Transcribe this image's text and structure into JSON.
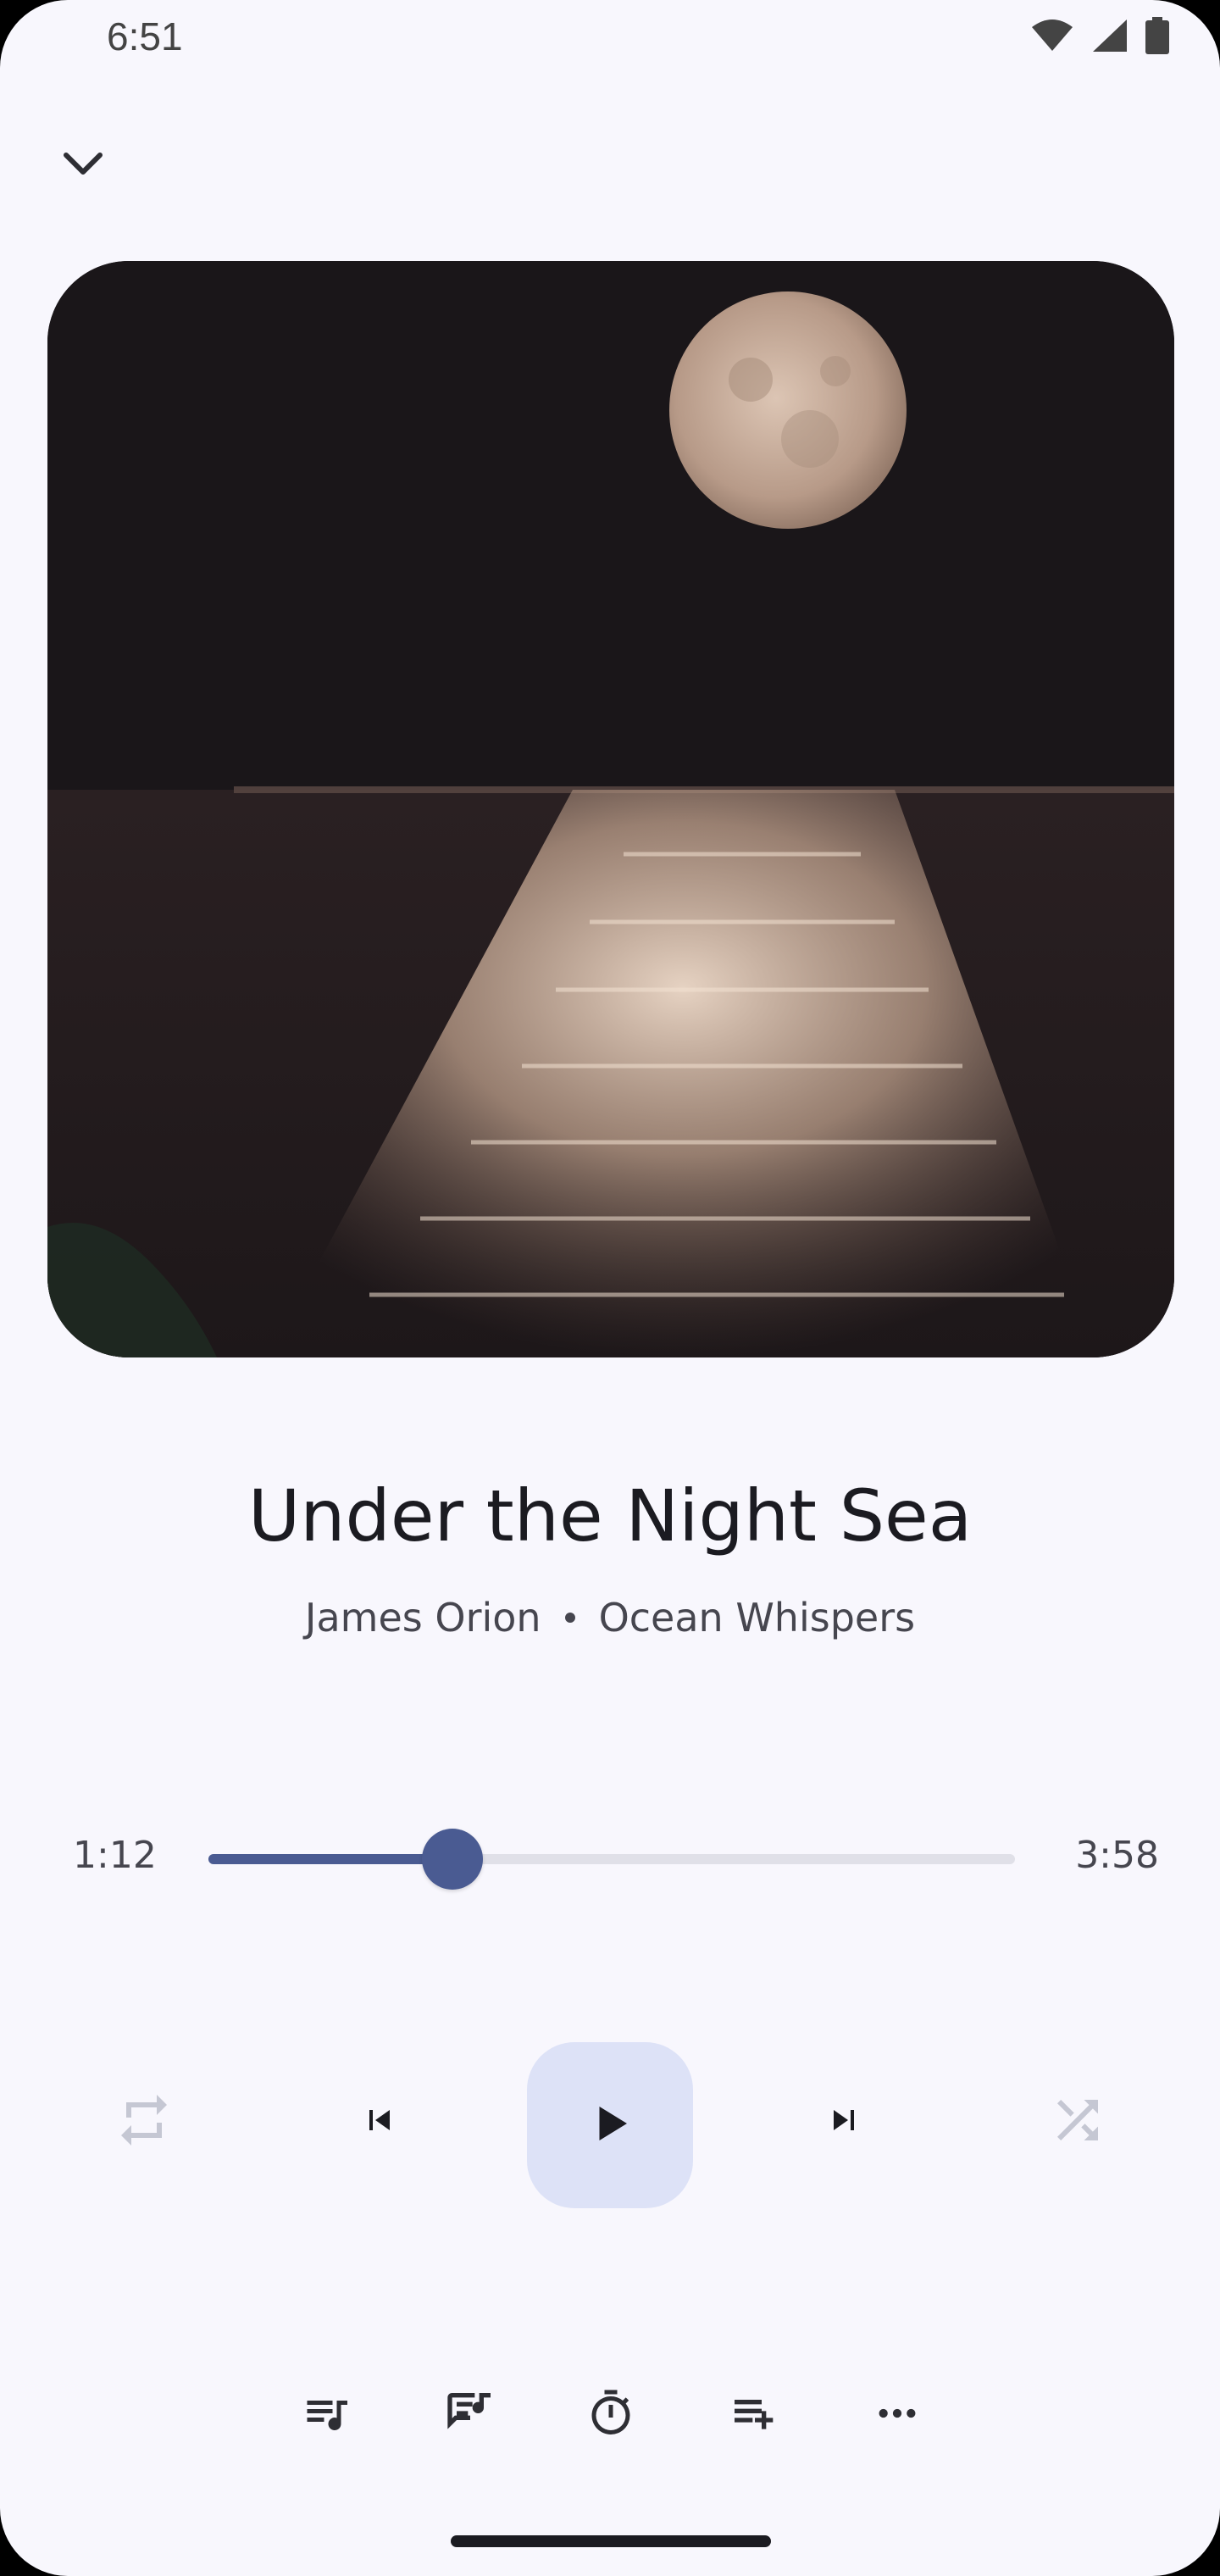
{
  "status_bar": {
    "time": "6:51",
    "icons": [
      "wifi-icon",
      "cell-signal-icon",
      "battery-icon"
    ]
  },
  "header": {
    "collapse_icon": "chevron-down-icon"
  },
  "artwork": {
    "description_icon": "album-art"
  },
  "track": {
    "title": "Under the Night Sea",
    "artist": "James Orion",
    "album": "Ocean Whispers"
  },
  "progress": {
    "elapsed": "1:12",
    "total": "3:58",
    "fraction": 0.303
  },
  "controls": {
    "repeat_icon": "repeat-icon",
    "previous_icon": "skip-previous-icon",
    "play_icon": "play-icon",
    "next_icon": "skip-next-icon",
    "shuffle_icon": "shuffle-icon"
  },
  "actions": {
    "items": [
      "queue-music-icon",
      "lyrics-icon",
      "sleep-timer-icon",
      "playlist-add-icon",
      "more-horizontal-icon"
    ]
  },
  "colors": {
    "background": "#f8f7fd",
    "accent": "#4a5b92",
    "play_button_bg": "#dde2f7",
    "text_primary": "#1b1b21",
    "text_secondary": "#46464f",
    "disabled_icon": "#c5c7d3"
  }
}
